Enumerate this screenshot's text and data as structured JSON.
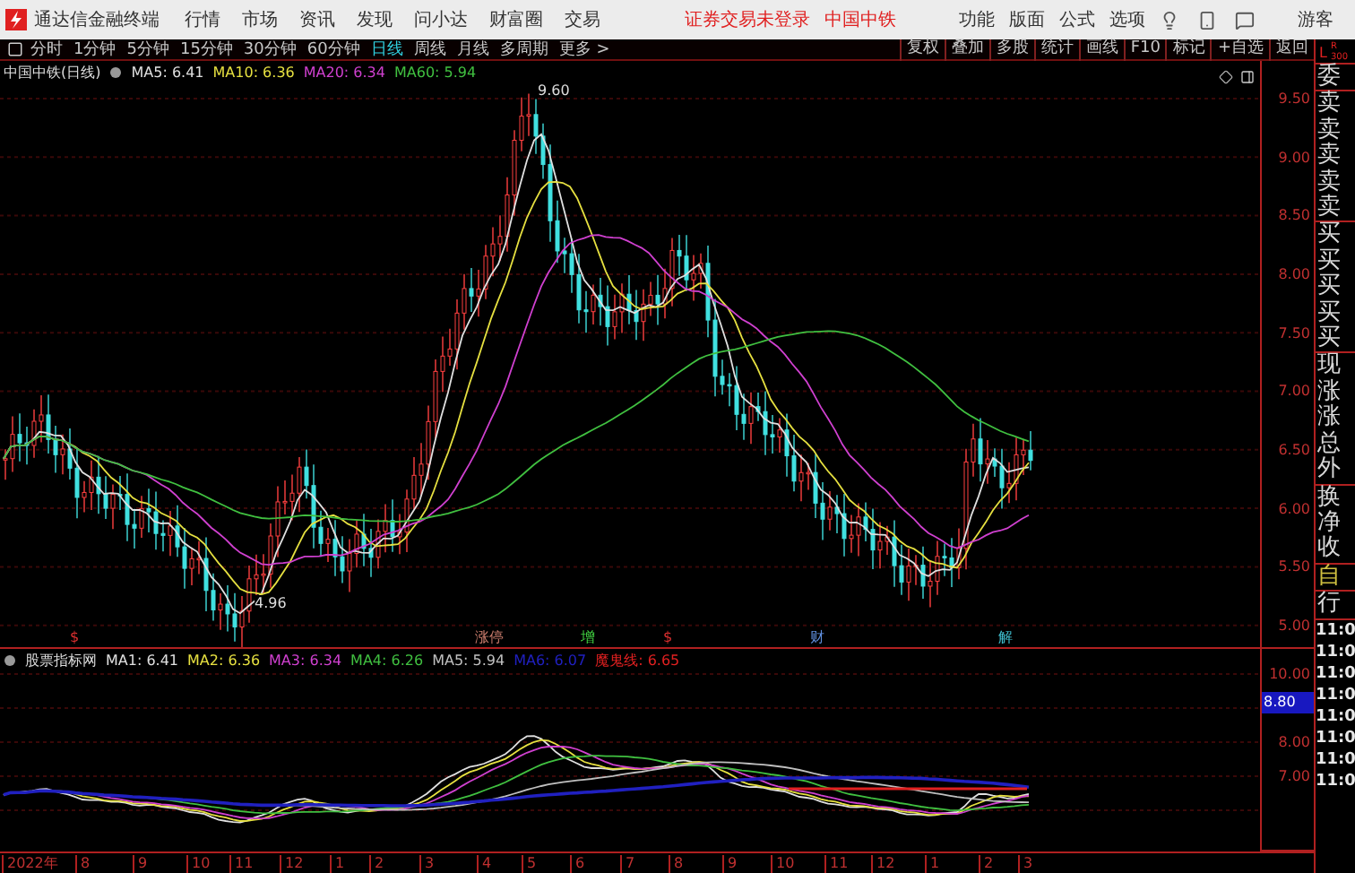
{
  "title_bar": {
    "app_name": "通达信金融终端",
    "menu": [
      "行情",
      "市场",
      "资讯",
      "发现",
      "问小达",
      "财富圈",
      "交易"
    ],
    "login_status": "证券交易未登录",
    "stock_name": "中国中铁",
    "menu_right": [
      "功能",
      "版面",
      "公式",
      "选项"
    ],
    "user": "游客"
  },
  "period_bar": {
    "periods": [
      {
        "label": "分时",
        "selected": false
      },
      {
        "label": "1分钟",
        "selected": false
      },
      {
        "label": "5分钟",
        "selected": false
      },
      {
        "label": "15分钟",
        "selected": false
      },
      {
        "label": "30分钟",
        "selected": false
      },
      {
        "label": "60分钟",
        "selected": false
      },
      {
        "label": "日线",
        "selected": true
      },
      {
        "label": "周线",
        "selected": false
      },
      {
        "label": "月线",
        "selected": false
      },
      {
        "label": "多周期",
        "selected": false
      }
    ],
    "more": "更多 >",
    "tools": [
      "复权",
      "叠加",
      "多股",
      "统计",
      "画线",
      "F10",
      "标记",
      "+自选",
      "返回"
    ]
  },
  "main_chart": {
    "title": "中国中铁(日线)",
    "legend": [
      {
        "label": "MA5: 6.41",
        "color": "#e0e0e0"
      },
      {
        "label": "MA10: 6.36",
        "color": "#e6e040"
      },
      {
        "label": "MA20: 6.34",
        "color": "#d040d0"
      },
      {
        "label": "MA60: 5.94",
        "color": "#40c040"
      }
    ],
    "high_label": "9.60",
    "low_label": "4.96",
    "price_ticks": [
      "9.50",
      "9.00",
      "8.50",
      "8.00",
      "7.50",
      "7.00",
      "6.50",
      "6.00",
      "5.50",
      "5.00"
    ]
  },
  "events": [
    {
      "label": "$",
      "color": "#e03030"
    },
    {
      "label": "涨停",
      "color": "#d08070"
    },
    {
      "label": "增",
      "color": "#40d040"
    },
    {
      "label": "$",
      "color": "#e03030"
    },
    {
      "label": "财",
      "color": "#6090e0"
    },
    {
      "label": "解",
      "color": "#40c0d0"
    }
  ],
  "indicator_panel": {
    "name": "股票指标网",
    "legend": [
      {
        "label": "MA1: 6.41",
        "color": "#e0e0e0"
      },
      {
        "label": "MA2: 6.36",
        "color": "#e6e040"
      },
      {
        "label": "MA3: 6.34",
        "color": "#d040d0"
      },
      {
        "label": "MA4: 6.26",
        "color": "#40c040"
      },
      {
        "label": "MA5: 5.94",
        "color": "#c0c0c0"
      },
      {
        "label": "MA6: 6.07",
        "color": "#2020c0"
      },
      {
        "label": "魔鬼线: 6.65",
        "color": "#e02020"
      }
    ],
    "ticks": [
      "10.00",
      "8.00",
      "7.00"
    ],
    "cursor_value": "8.80"
  },
  "date_axis": [
    "2022年",
    "8",
    "9",
    "10",
    "11",
    "12",
    "1",
    "2",
    "3",
    "4",
    "5",
    "6",
    "7",
    "8",
    "9",
    "10",
    "11",
    "12",
    "1",
    "2",
    "3"
  ],
  "quote_panel": {
    "header": [
      "L",
      "R",
      "300"
    ],
    "groups": [
      [
        {
          "label": "委",
          "kind": "field"
        }
      ],
      [
        {
          "label": "卖",
          "kind": "field"
        },
        {
          "label": "卖",
          "kind": "field"
        },
        {
          "label": "卖",
          "kind": "field"
        },
        {
          "label": "卖",
          "kind": "field"
        },
        {
          "label": "卖",
          "kind": "field"
        }
      ],
      [
        {
          "label": "买",
          "kind": "field"
        },
        {
          "label": "买",
          "kind": "field"
        },
        {
          "label": "买",
          "kind": "field"
        },
        {
          "label": "买",
          "kind": "field"
        },
        {
          "label": "买",
          "kind": "field"
        }
      ],
      [
        {
          "label": "现",
          "kind": "field"
        },
        {
          "label": "涨",
          "kind": "field"
        },
        {
          "label": "涨",
          "kind": "field"
        },
        {
          "label": "总",
          "kind": "field"
        },
        {
          "label": "外",
          "kind": "field"
        }
      ],
      [
        {
          "label": "换",
          "kind": "field"
        },
        {
          "label": "净",
          "kind": "field"
        },
        {
          "label": "收",
          "kind": "field"
        }
      ],
      [
        {
          "label": "自",
          "kind": "mode"
        }
      ],
      [
        {
          "label": "行",
          "kind": "field"
        }
      ]
    ],
    "times": [
      "11:0",
      "11:0",
      "11:0",
      "11:0",
      "11:0",
      "11:0",
      "11:0",
      "11:0"
    ]
  }
}
